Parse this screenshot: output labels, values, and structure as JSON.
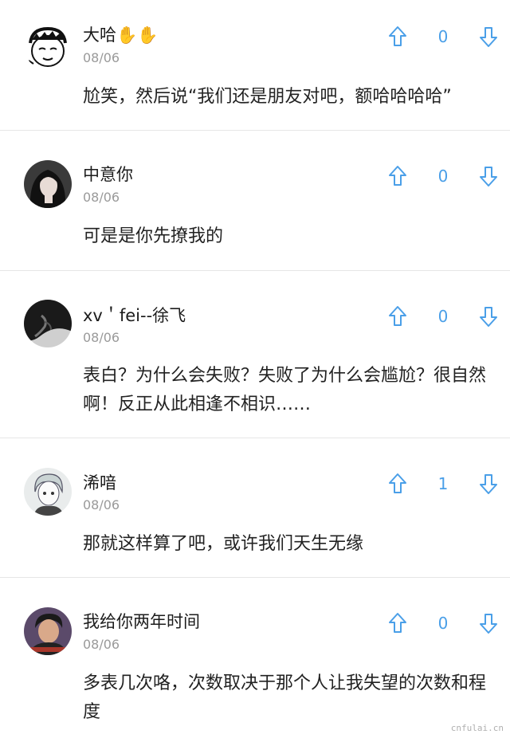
{
  "comments": [
    {
      "username": "大哈",
      "emoji": "✋✋",
      "date": "08/06",
      "votes": "0",
      "text": "尬笑，然后说“我们还是朋友对吧，额哈哈哈哈”"
    },
    {
      "username": "中意你",
      "date": "08/06",
      "votes": "0",
      "text": "可是是你先撩我的"
    },
    {
      "username": "xv＇fei--徐飞",
      "date": "08/06",
      "votes": "0",
      "text": "表白？为什么会失败？失败了为什么会尴尬？很自然啊！反正从此相逢不相识……"
    },
    {
      "username": "浠喑",
      "date": "08/06",
      "votes": "1",
      "text": "那就这样算了吧，或许我们天生无缘"
    },
    {
      "username": "我给你两年时间",
      "date": "08/06",
      "votes": "0",
      "text": "多表几次咯，次数取决于那个人让我失望的次数和程度"
    }
  ],
  "watermark": "cnfulai.cn",
  "colors": {
    "accent": "#4a9fe8",
    "divider": "#e6e6e6",
    "date": "#9a9a9a"
  }
}
